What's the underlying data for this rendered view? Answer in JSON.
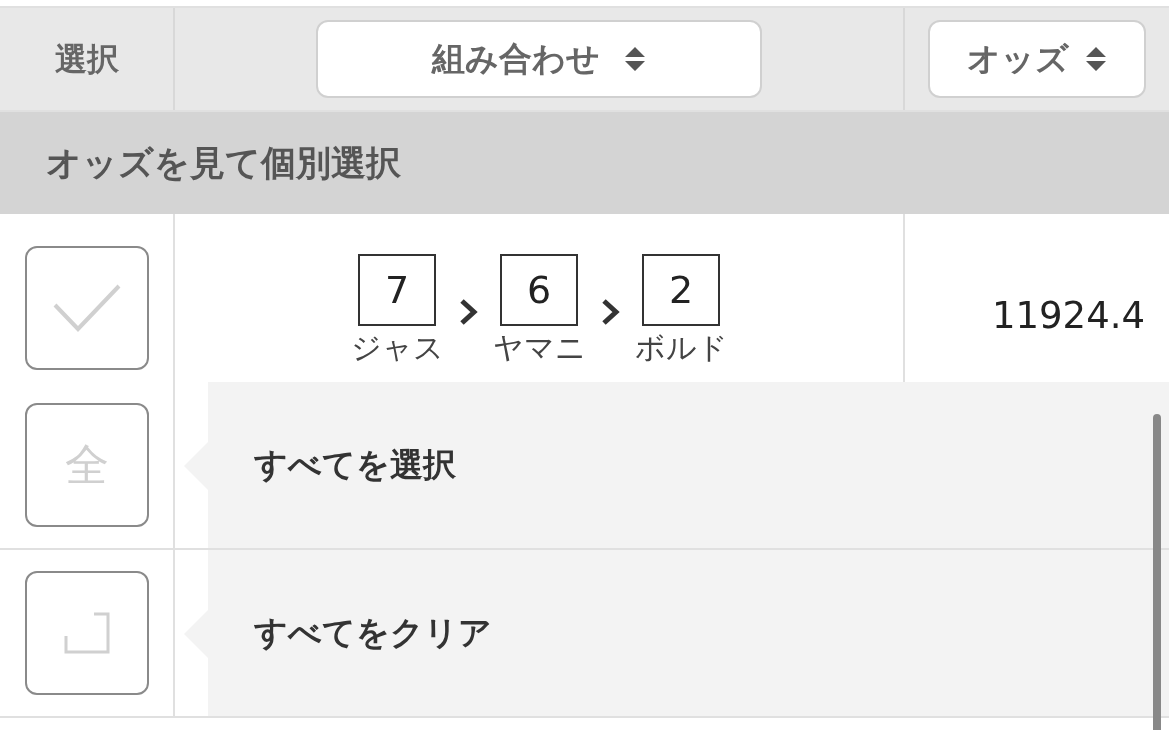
{
  "header": {
    "select_label": "選択",
    "combination_button": "組み合わせ",
    "odds_button": "オッズ"
  },
  "section_title": "オッズを見て個別選択",
  "rows": [
    {
      "checked": false,
      "combination": [
        {
          "number": "7",
          "name": "ジャス"
        },
        {
          "number": "6",
          "name": "ヤマニ"
        },
        {
          "number": "2",
          "name": "ボルド"
        }
      ],
      "odds": "11924.4"
    }
  ],
  "actions": [
    {
      "kind": "select_all",
      "icon_text": "全",
      "label": "すべてを選択"
    },
    {
      "kind": "clear",
      "label": "すべてをクリア"
    }
  ]
}
